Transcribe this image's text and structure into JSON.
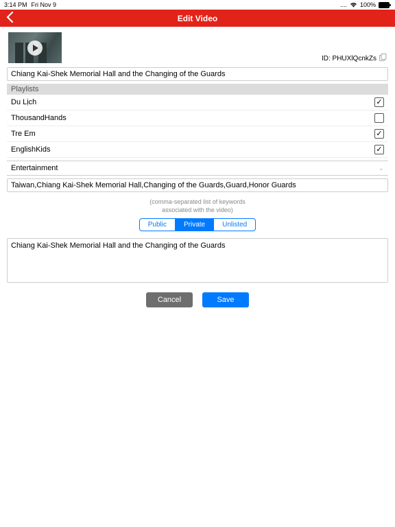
{
  "statusBar": {
    "time": "3:14 PM",
    "date": "Fri Nov 9",
    "battery": "100%"
  },
  "header": {
    "title": "Edit Video"
  },
  "video": {
    "idLabel": "ID: PHUXlQcnkZs",
    "title": "Chiang Kai-Shek Memorial Hall and the Changing of the Guards"
  },
  "playlistsHeader": "Playlists",
  "playlists": [
    {
      "name": "Du Lịch",
      "checked": true
    },
    {
      "name": "ThousandHands",
      "checked": false
    },
    {
      "name": "Tre Em",
      "checked": true
    },
    {
      "name": "EnglishKids",
      "checked": true
    }
  ],
  "category": "Entertainment",
  "tags": "Taiwan,Chiang Kai-Shek Memorial Hall,Changing of the Guards,Guard,Honor Guards",
  "tagsHint1": "(comma-separated list of keywords",
  "tagsHint2": "associated with the video)",
  "privacy": {
    "options": [
      "Public",
      "Private",
      "Unlisted"
    ],
    "selected": "Private"
  },
  "description": "Chiang Kai-Shek Memorial Hall and the Changing of the Guards",
  "buttons": {
    "cancel": "Cancel",
    "save": "Save"
  }
}
